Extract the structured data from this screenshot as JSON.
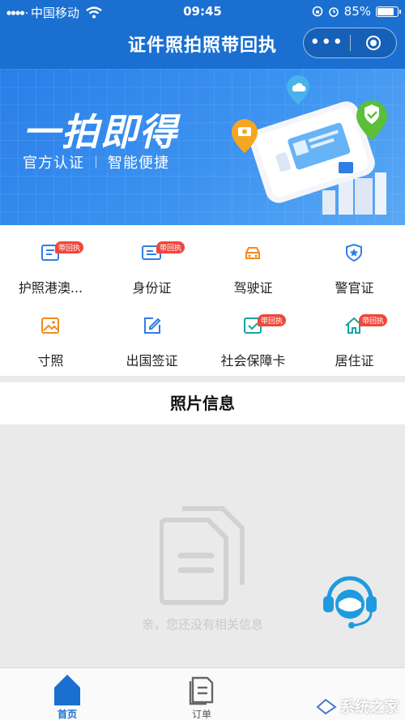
{
  "status_bar": {
    "carrier": "中国移动",
    "time": "09:45",
    "battery": "85%",
    "battery_level": 0.85
  },
  "nav": {
    "title": "证件照拍照带回执",
    "more_icon": "more-dots-icon",
    "close_icon": "target-circle-icon"
  },
  "banner": {
    "title": "一拍即得",
    "subtitle_left": "官方认证",
    "subtitle_right": "智能便捷"
  },
  "categories": [
    {
      "label": "护照港澳...",
      "badge": "带回执",
      "icon": "passport-icon",
      "color": "#2f7ee6"
    },
    {
      "label": "身份证",
      "badge": "带回执",
      "icon": "id-card-icon",
      "color": "#2f7ee6"
    },
    {
      "label": "驾驶证",
      "badge": "",
      "icon": "car-icon",
      "color": "#f08a24"
    },
    {
      "label": "警官证",
      "badge": "",
      "icon": "police-shield-icon",
      "color": "#2f7ee6"
    },
    {
      "label": "寸照",
      "badge": "",
      "icon": "photo-icon",
      "color": "#f08a24"
    },
    {
      "label": "出国签证",
      "badge": "",
      "icon": "visa-edit-icon",
      "color": "#2f7ee6"
    },
    {
      "label": "社会保障卡",
      "badge": "带回执",
      "icon": "social-security-card-icon",
      "color": "#1aa39a"
    },
    {
      "label": "居住证",
      "badge": "带回执",
      "icon": "home-icon",
      "color": "#1aa39a"
    }
  ],
  "photo_section": {
    "title": "照片信息",
    "empty_text": "亲，您还没有相关信息"
  },
  "tabs": [
    {
      "label": "首页",
      "icon": "home-tab-icon",
      "active": true
    },
    {
      "label": "订单",
      "icon": "order-document-icon",
      "active": false
    }
  ],
  "watermark": "系统之家",
  "colors": {
    "primary": "#1a6fd1",
    "badge": "#f0473b"
  }
}
